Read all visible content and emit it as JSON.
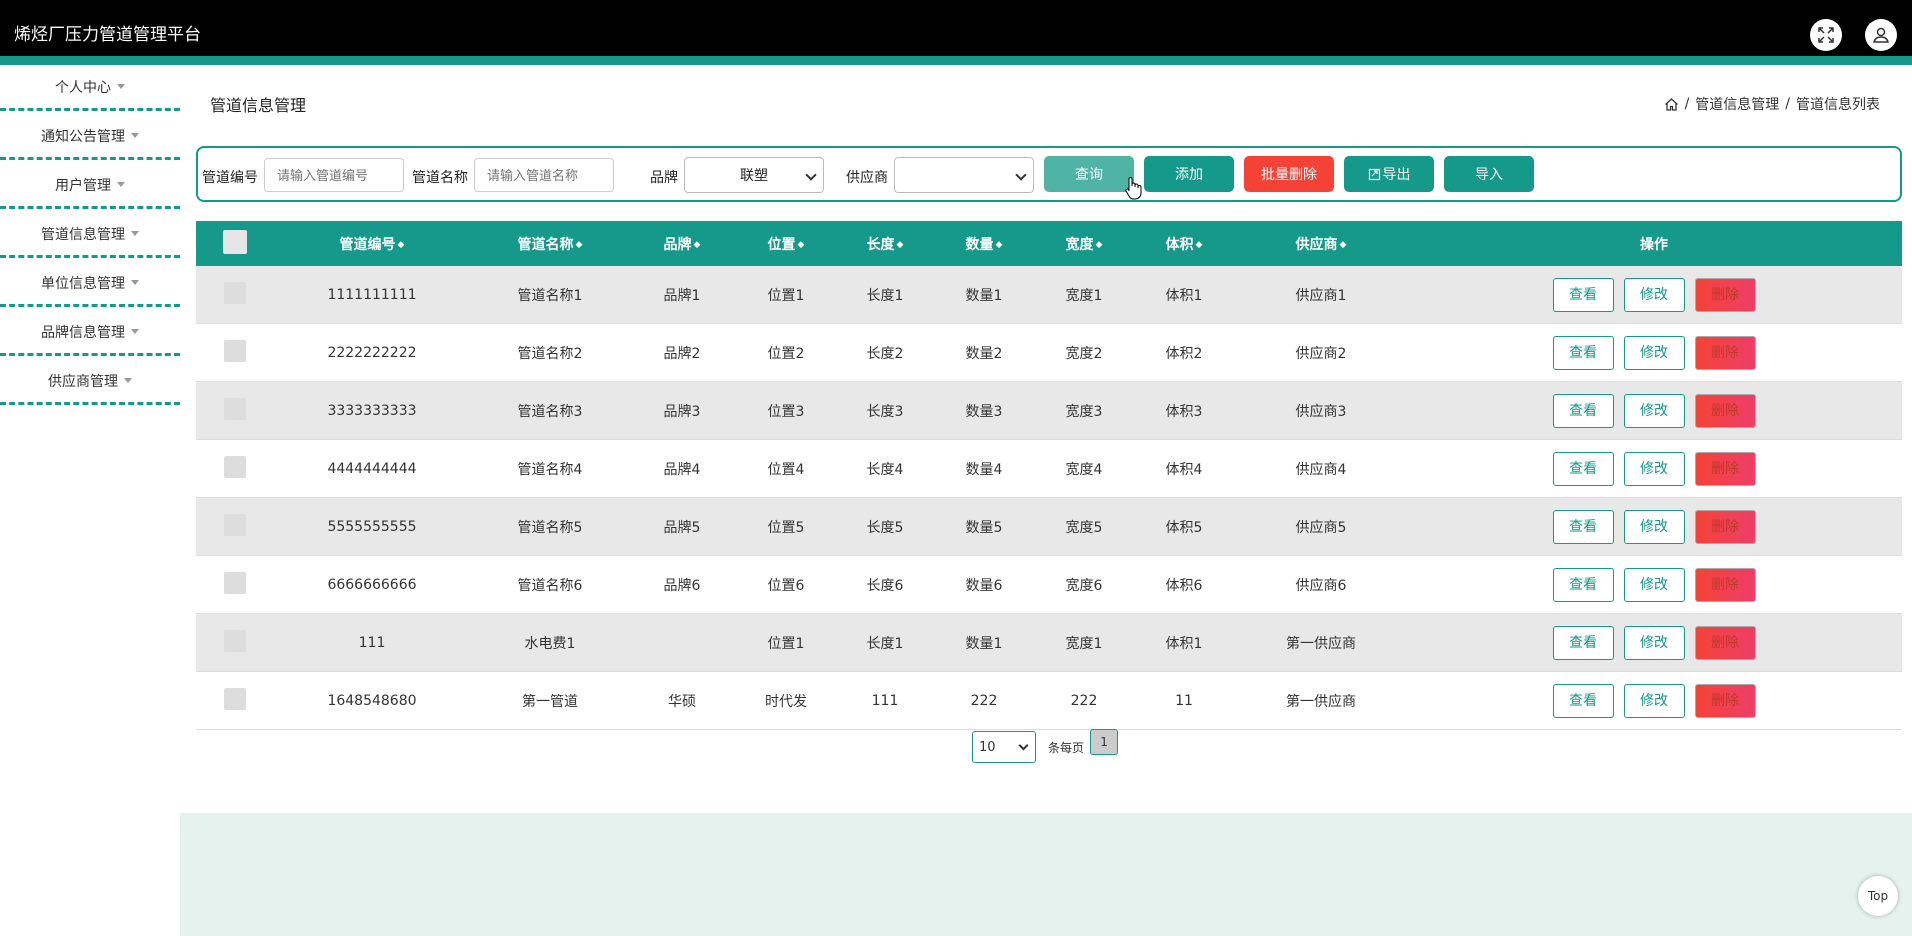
{
  "app": {
    "title": "烯烃厂压力管道管理平台"
  },
  "sidebar": {
    "items": [
      {
        "label": "个人中心"
      },
      {
        "label": "通知公告管理"
      },
      {
        "label": "用户管理"
      },
      {
        "label": "管道信息管理"
      },
      {
        "label": "单位信息管理"
      },
      {
        "label": "品牌信息管理"
      },
      {
        "label": "供应商管理"
      }
    ]
  },
  "page": {
    "title": "管道信息管理"
  },
  "breadcrumb": {
    "level1": "管道信息管理",
    "level2": "管道信息列表",
    "separator": "/"
  },
  "search": {
    "code_label": "管道编号",
    "code_placeholder": "请输入管道编号",
    "name_label": "管道名称",
    "name_placeholder": "请输入管道名称",
    "brand_label": "品牌",
    "brand_value": "联塑",
    "supplier_label": "供应商",
    "supplier_value": "",
    "query_label": "查询",
    "add_label": "添加",
    "batch_delete_label": "批量删除",
    "export_label": "导出",
    "import_label": "导入"
  },
  "table": {
    "headers": [
      "管道编号",
      "管道名称",
      "品牌",
      "位置",
      "长度",
      "数量",
      "宽度",
      "体积",
      "供应商",
      "操作"
    ],
    "rows": [
      [
        "1111111111",
        "管道名称1",
        "品牌1",
        "位置1",
        "长度1",
        "数量1",
        "宽度1",
        "体积1",
        "供应商1"
      ],
      [
        "2222222222",
        "管道名称2",
        "品牌2",
        "位置2",
        "长度2",
        "数量2",
        "宽度2",
        "体积2",
        "供应商2"
      ],
      [
        "3333333333",
        "管道名称3",
        "品牌3",
        "位置3",
        "长度3",
        "数量3",
        "宽度3",
        "体积3",
        "供应商3"
      ],
      [
        "4444444444",
        "管道名称4",
        "品牌4",
        "位置4",
        "长度4",
        "数量4",
        "宽度4",
        "体积4",
        "供应商4"
      ],
      [
        "5555555555",
        "管道名称5",
        "品牌5",
        "位置5",
        "长度5",
        "数量5",
        "宽度5",
        "体积5",
        "供应商5"
      ],
      [
        "6666666666",
        "管道名称6",
        "品牌6",
        "位置6",
        "长度6",
        "数量6",
        "宽度6",
        "体积6",
        "供应商6"
      ],
      [
        "111",
        "水电费1",
        "",
        "位置1",
        "长度1",
        "数量1",
        "宽度1",
        "体积1",
        "第一供应商"
      ],
      [
        "1648548680",
        "第一管道",
        "华硕",
        "时代发",
        "111",
        "222",
        "222",
        "11",
        "第一供应商"
      ]
    ],
    "actions": {
      "view": "查看",
      "edit": "修改",
      "delete": "删除"
    }
  },
  "pagination": {
    "page_size": "10",
    "per_page_label": "条每页",
    "current_page": "1"
  },
  "back_to_top": "Top",
  "colors": {
    "accent": "#14998a",
    "danger": "#f44336",
    "topbar": "#000000",
    "footer": "#e5f2ee"
  }
}
